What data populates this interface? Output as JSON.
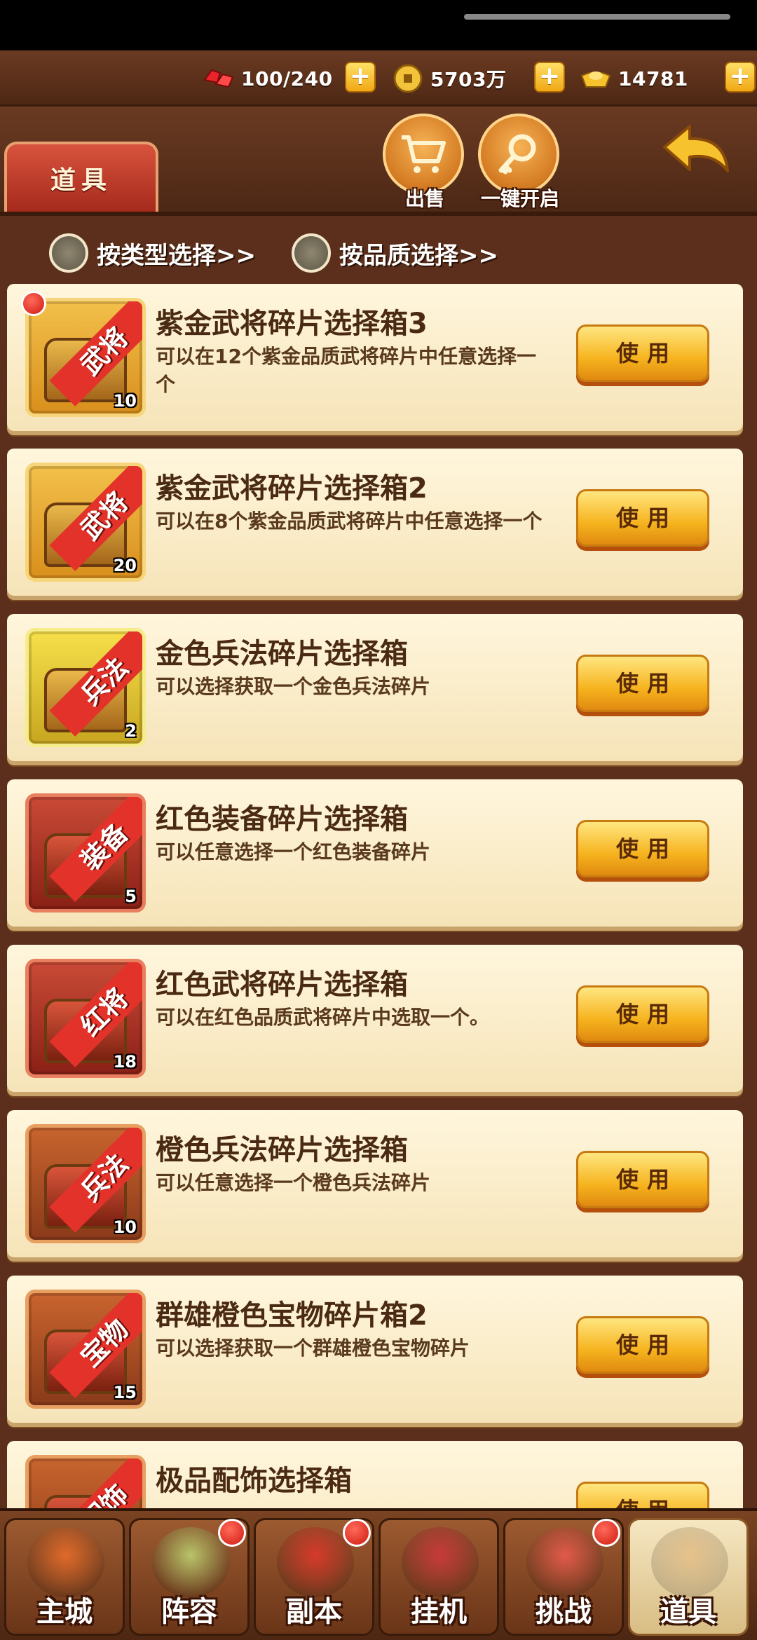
{
  "resources": {
    "stamina": "100/240",
    "coins": "5703万",
    "ingots": "14781"
  },
  "header": {
    "tab_title": "道具",
    "sell_label": "出售",
    "open_all_label": "一键开启"
  },
  "filters": {
    "by_type": "按类型选择>>",
    "by_quality": "按品质选择>>"
  },
  "use_label": "使用",
  "items": [
    {
      "name": "紫金武将碎片选择箱3",
      "desc": "可以在12个紫金品质武将碎片中任意选择一个",
      "tag": "武将",
      "count": "10",
      "frame": "gold",
      "new": true
    },
    {
      "name": "紫金武将碎片选择箱2",
      "desc": "可以在8个紫金品质武将碎片中任意选择一个",
      "tag": "武将",
      "count": "20",
      "frame": "gold",
      "new": false
    },
    {
      "name": "金色兵法碎片选择箱",
      "desc": "可以选择获取一个金色兵法碎片",
      "tag": "兵法",
      "count": "2",
      "frame": "yellow",
      "new": false
    },
    {
      "name": "红色装备碎片选择箱",
      "desc": "可以任意选择一个红色装备碎片",
      "tag": "装备",
      "count": "5",
      "frame": "red",
      "new": false
    },
    {
      "name": "红色武将碎片选择箱",
      "desc": "可以在红色品质武将碎片中选取一个。",
      "tag": "红将",
      "count": "18",
      "frame": "red",
      "new": false
    },
    {
      "name": "橙色兵法碎片选择箱",
      "desc": "可以任意选择一个橙色兵法碎片",
      "tag": "兵法",
      "count": "10",
      "frame": "orange",
      "new": false
    },
    {
      "name": "群雄橙色宝物碎片箱2",
      "desc": "可以选择获取一个群雄橙色宝物碎片",
      "tag": "宝物",
      "count": "15",
      "frame": "orange",
      "new": false
    },
    {
      "name": "极品配饰选择箱",
      "desc": "",
      "tag": "配饰",
      "count": "",
      "frame": "orange",
      "new": false
    }
  ],
  "nav": [
    {
      "label": "主城",
      "dot": false,
      "active": false
    },
    {
      "label": "阵容",
      "dot": true,
      "active": false
    },
    {
      "label": "副本",
      "dot": true,
      "active": false
    },
    {
      "label": "挂机",
      "dot": false,
      "active": false
    },
    {
      "label": "挑战",
      "dot": true,
      "active": false
    },
    {
      "label": "道具",
      "dot": false,
      "active": true
    }
  ],
  "colors": {
    "accent": "#f6b31e",
    "panel": "#5b2f1b",
    "card": "#fff6dd",
    "ribbon": "#e3322a"
  }
}
